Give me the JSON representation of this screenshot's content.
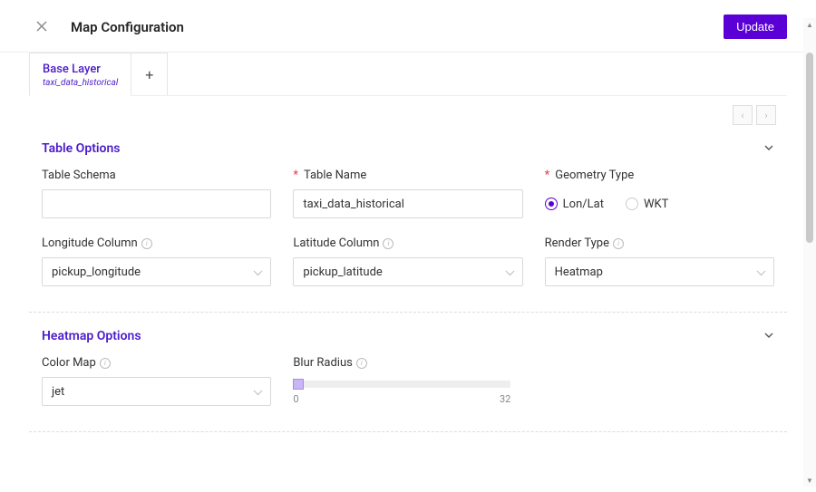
{
  "header": {
    "title": "Map Configuration",
    "update_label": "Update"
  },
  "tabs": {
    "base_layer_label": "Base Layer",
    "base_layer_sub": "taxi_data_historical",
    "add_symbol": "+"
  },
  "pager": {
    "prev": "‹",
    "next": "›"
  },
  "table_options": {
    "section_title": "Table Options",
    "table_schema_label": "Table Schema",
    "table_schema_value": "",
    "table_name_label": "Table Name",
    "table_name_value": "taxi_data_historical",
    "geometry_type_label": "Geometry Type",
    "geometry_type_options": {
      "lonlat": "Lon/Lat",
      "wkt": "WKT"
    },
    "geometry_type_selected": "lonlat",
    "longitude_label": "Longitude Column",
    "longitude_value": "pickup_longitude",
    "latitude_label": "Latitude Column",
    "latitude_value": "pickup_latitude",
    "render_type_label": "Render Type",
    "render_type_value": "Heatmap"
  },
  "heatmap_options": {
    "section_title": "Heatmap Options",
    "color_map_label": "Color Map",
    "color_map_value": "jet",
    "blur_radius_label": "Blur Radius",
    "blur_radius_min": "0",
    "blur_radius_max": "32",
    "blur_radius_value": 0
  },
  "icons": {
    "info": "i",
    "chevron_down": "⌄"
  }
}
